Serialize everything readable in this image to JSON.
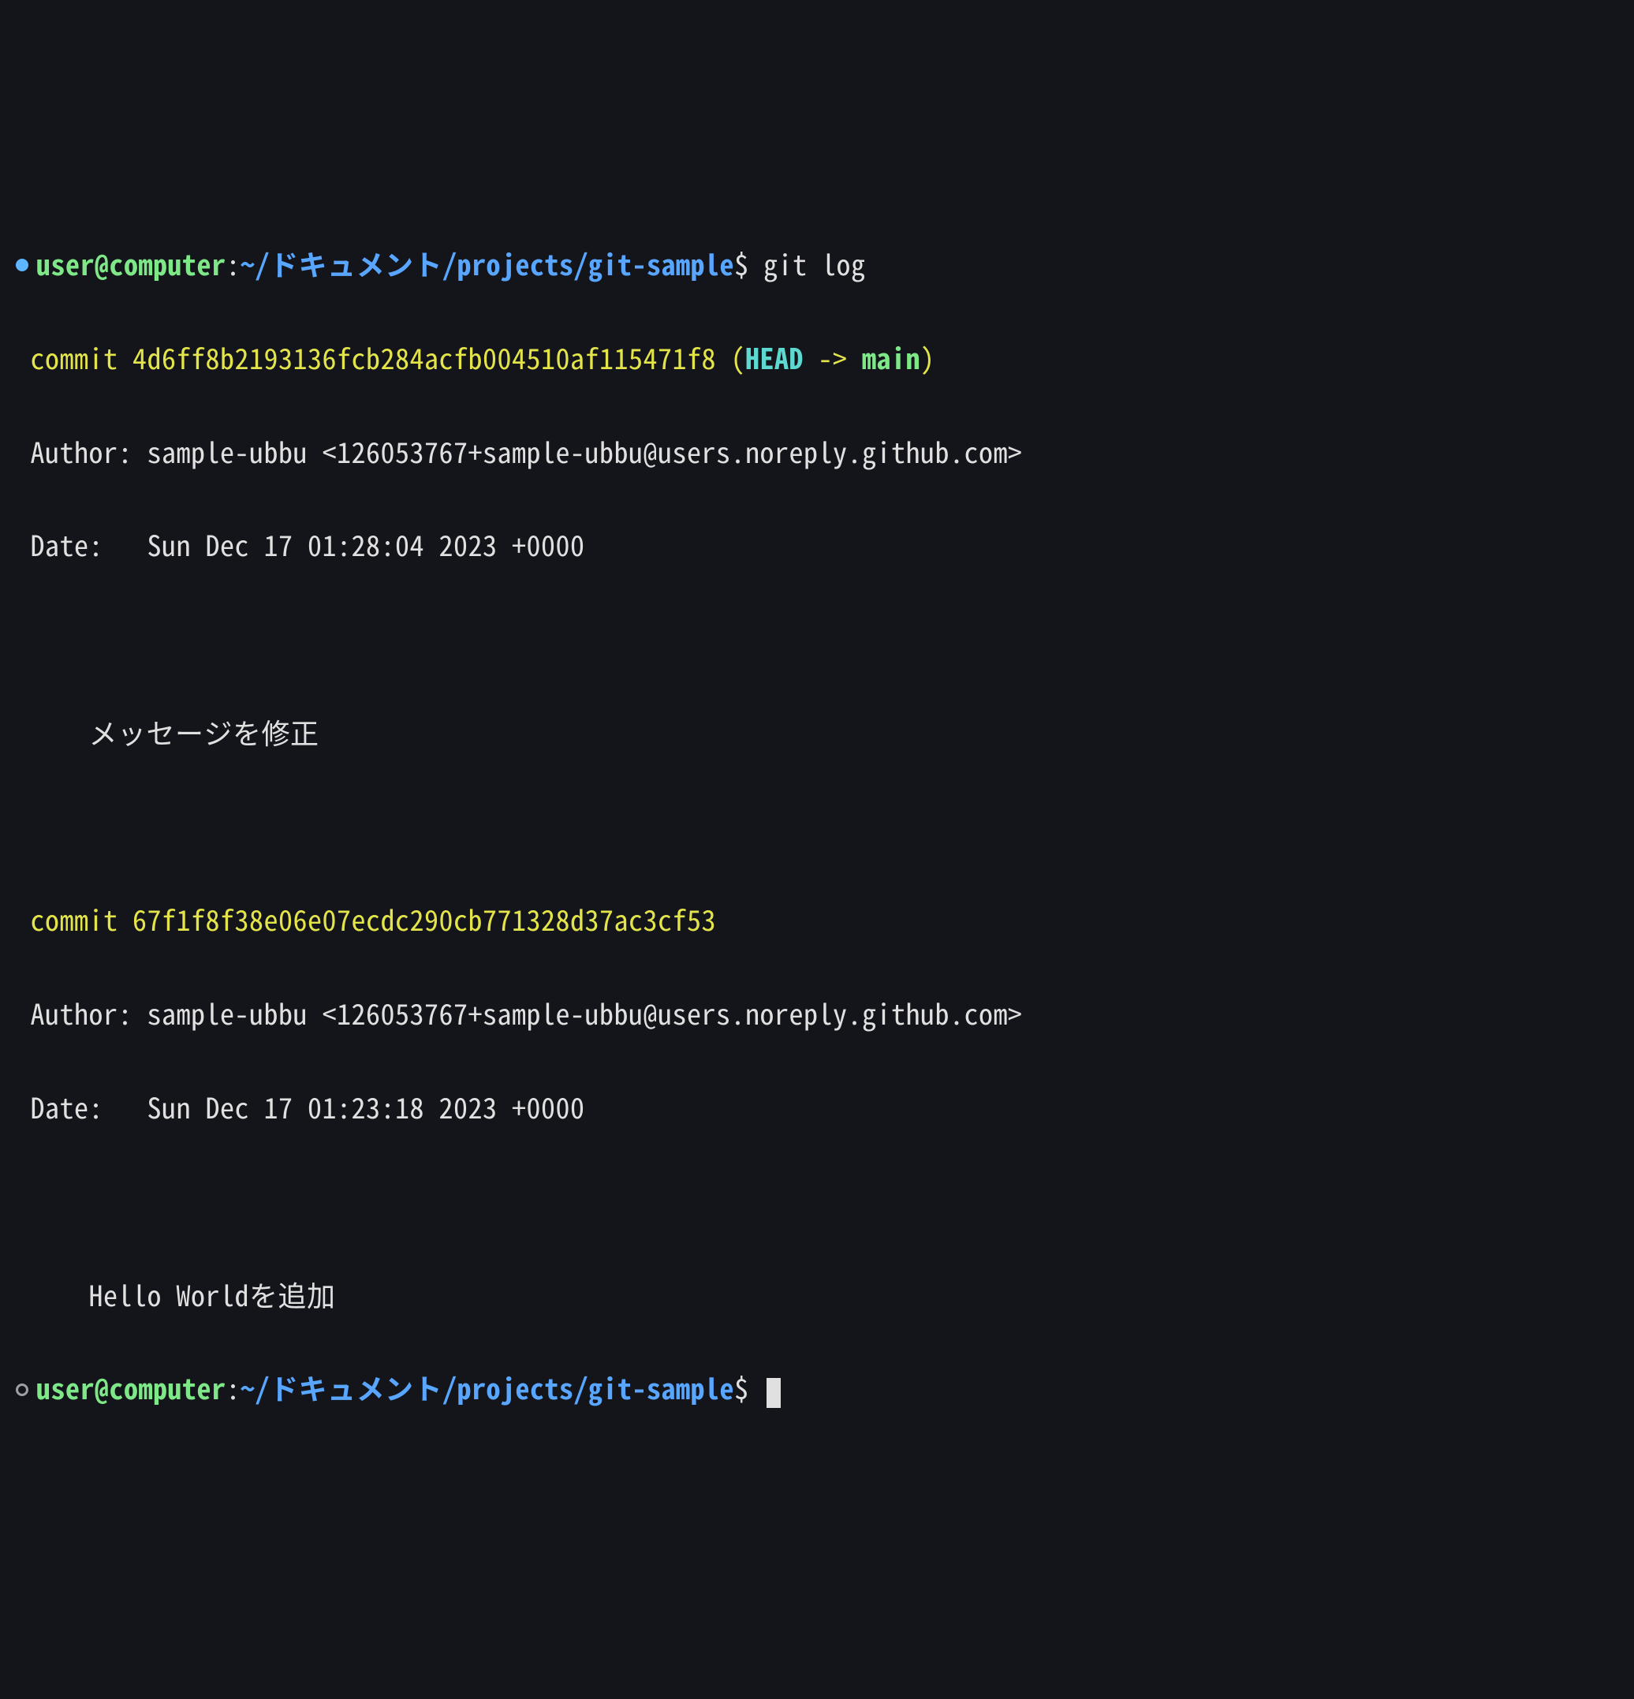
{
  "prompt1": {
    "bullet": "filled",
    "user_host": "user@computer",
    "sep": ":",
    "path": "~/ドキュメント/projects/git-sample",
    "dollar": "$",
    "command": "git log"
  },
  "commits": [
    {
      "label": "commit",
      "hash": "4d6ff8b2193136fcb284acfb004510af115471f8",
      "refs": {
        "open": " (",
        "head": "HEAD",
        "arrow": " -> ",
        "branch": "main",
        "close": ")"
      },
      "author_label": "Author: ",
      "author": "sample-ubbu <126053767+sample-ubbu@users.noreply.github.com>",
      "date_label": "Date:   ",
      "date": "Sun Dec 17 01:28:04 2023 +0000",
      "message": "メッセージを修正"
    },
    {
      "label": "commit",
      "hash": "67f1f8f38e06e07ecdc290cb771328d37ac3cf53",
      "refs": null,
      "author_label": "Author: ",
      "author": "sample-ubbu <126053767+sample-ubbu@users.noreply.github.com>",
      "date_label": "Date:   ",
      "date": "Sun Dec 17 01:23:18 2023 +0000",
      "message": "Hello Worldを追加"
    }
  ],
  "prompt2": {
    "bullet": "open",
    "user_host": "user@computer",
    "sep": ":",
    "path": "~/ドキュメント/projects/git-sample",
    "dollar": "$",
    "command": ""
  }
}
